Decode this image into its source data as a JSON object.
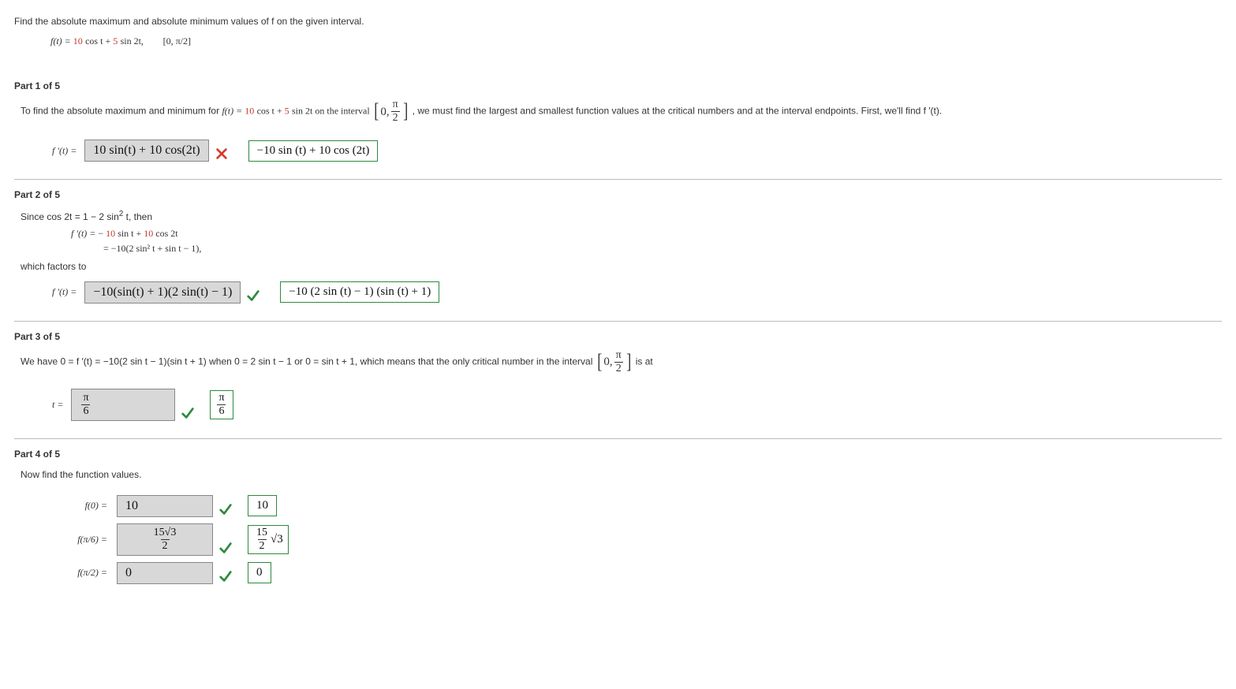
{
  "problem": {
    "prompt": "Find the absolute maximum and absolute minimum values of f on the given interval.",
    "function_prefix": "f(t) = ",
    "coeff_a": "10",
    "mid1": " cos t + ",
    "coeff_b": "5",
    "mid2": " sin 2t,",
    "interval": "[0, π/2]"
  },
  "part1": {
    "title": "Part 1 of 5",
    "text_a": "To find the absolute maximum and minimum for  ",
    "fn_prefix": "f(t) = ",
    "coeff_a": "10",
    "mid1": " cos t + ",
    "coeff_b": "5",
    "mid2": " sin 2t  on the interval ",
    "interval_open": "0, ",
    "interval_num": "π",
    "interval_den": "2",
    "text_b": ",  we must find the largest and smallest function values at the critical numbers and at the interval endpoints. First, we'll find f ′(t).",
    "lead": "f ′(t)  =",
    "student": "10 sin(t) + 10 cos(2t)",
    "correct_status": "wrong",
    "correct": "−10 sin (t) + 10 cos (2t)"
  },
  "part2": {
    "title": "Part 2 of 5",
    "line1_a": "Since  cos 2t = 1 − 2 sin",
    "line1_b": " t,  then",
    "eq1_lead": "f ′(t)  =  ",
    "eq1_a": "−",
    "eq1_coef": "10",
    "eq1_b": " sin t + ",
    "eq1_coef2": "10",
    "eq1_c": " cos 2t",
    "eq2_lead": "=  ",
    "eq2": "−10(2 sin² t + sin t − 1),",
    "line2": "which factors to",
    "ans_lead": "f ′(t)  =",
    "student": "−10(sin(t) + 1)(2 sin(t) − 1)",
    "correct_status": "ok",
    "correct": "−10 (2 sin (t) − 1) (sin (t) + 1)"
  },
  "part3": {
    "title": "Part 3 of 5",
    "text_a": "We have  0 = f ′(t) = −10(2 sin t − 1)(sin t + 1)  when  0 = 2 sin t − 1 or 0 = sin t + 1,  which means that the only critical number in the interval ",
    "interval_open": "0, ",
    "interval_num": "π",
    "interval_den": "2",
    "text_b": "  is at",
    "ans_lead": "t  =",
    "student_num": "π",
    "student_den": "6",
    "correct_status": "ok",
    "correct_num": "π",
    "correct_den": "6"
  },
  "part4": {
    "title": "Part 4 of 5",
    "intro": "Now find the function values.",
    "rows": [
      {
        "label": "f(0)  =",
        "student": "10",
        "status": "ok",
        "correct": "10"
      },
      {
        "label": "f(π/6)  =",
        "student_frac": {
          "num": "15√3",
          "den": "2"
        },
        "status": "ok",
        "correct_frac_prefix_num": "15",
        "correct_frac_den": "2",
        "correct_suffix": "√3"
      },
      {
        "label": "f(π/2)  =",
        "student": "0",
        "status": "ok",
        "correct": "0"
      }
    ]
  }
}
